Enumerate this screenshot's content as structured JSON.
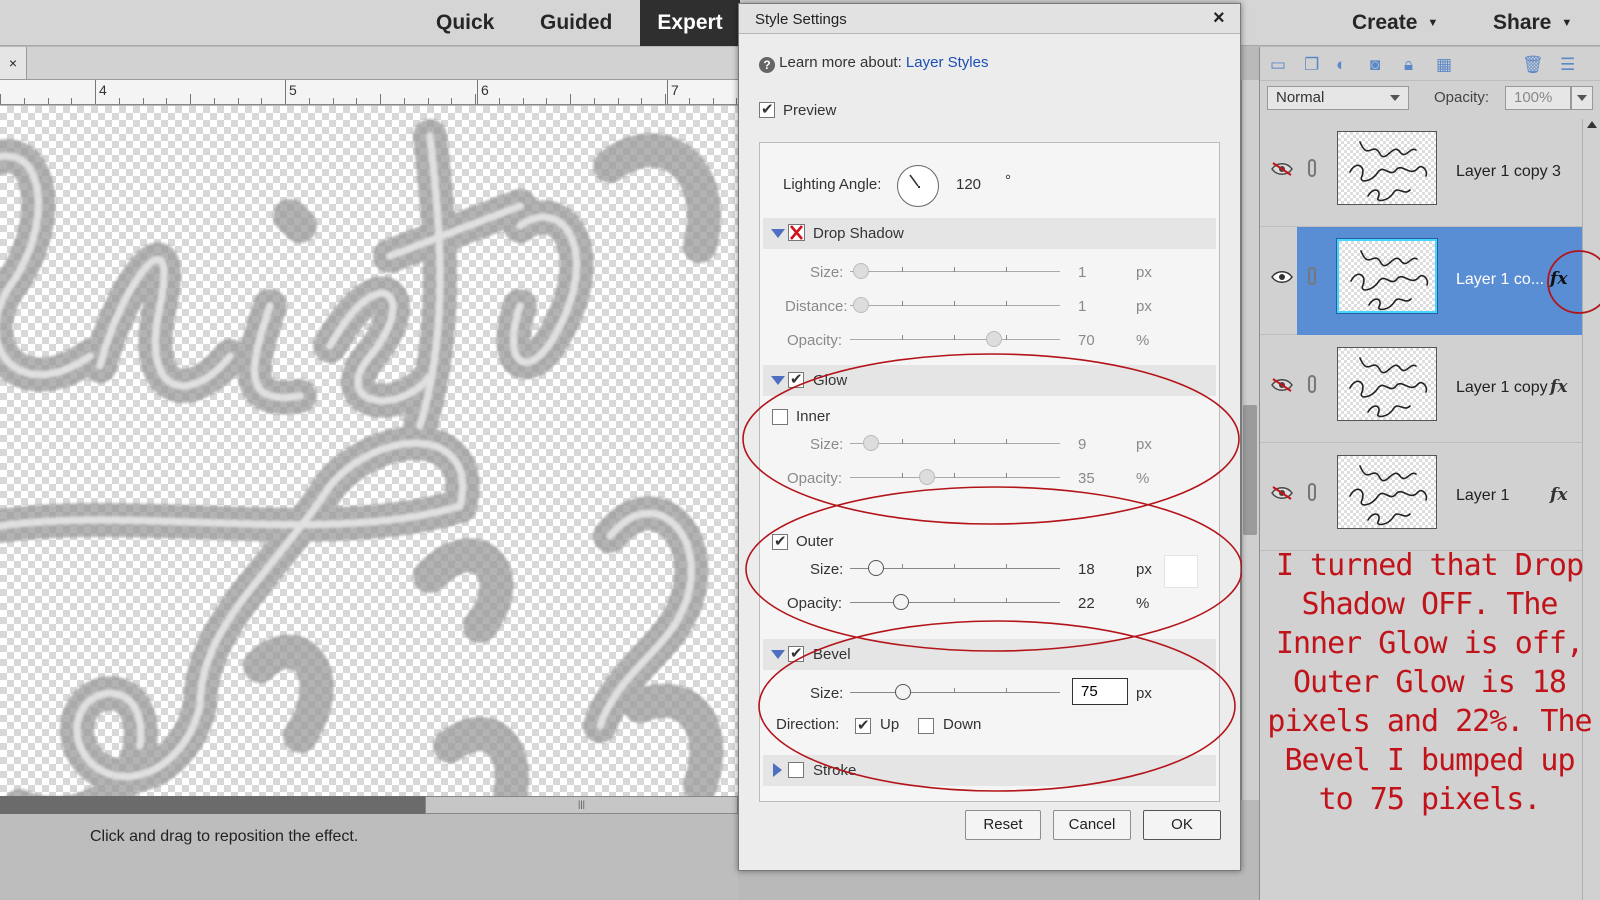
{
  "top_bar": {
    "modes": [
      "Quick",
      "Guided",
      "Expert"
    ],
    "active_mode": "Expert",
    "create_label": "Create",
    "share_label": "Share"
  },
  "canvas": {
    "tab_close": "×",
    "ruler_numbers": [
      "4",
      "5",
      "6",
      "7"
    ],
    "status_text": "Click and drag to reposition the effect.",
    "hscroll_grip": "|||"
  },
  "dialog": {
    "title": "Style Settings",
    "close": "×",
    "learn_more_text": "Learn more about:",
    "learn_more_link": "Layer Styles",
    "preview_label": "Preview",
    "preview_checked": true,
    "lighting_angle_label": "Lighting Angle:",
    "lighting_angle_value": "120",
    "degree_symbol": "°",
    "drop_shadow": {
      "title": "Drop Shadow",
      "enabled": false,
      "size_label": "Size:",
      "size_value": "1",
      "size_unit": "px",
      "distance_label": "Distance:",
      "distance_value": "1",
      "distance_unit": "px",
      "opacity_label": "Opacity:",
      "opacity_value": "70",
      "opacity_unit": "%"
    },
    "glow": {
      "title": "Glow",
      "enabled": true,
      "inner_label": "Inner",
      "inner_checked": false,
      "inner_size_label": "Size:",
      "inner_size_value": "9",
      "inner_size_unit": "px",
      "inner_opacity_label": "Opacity:",
      "inner_opacity_value": "35",
      "inner_opacity_unit": "%",
      "outer_label": "Outer",
      "outer_checked": true,
      "outer_size_label": "Size:",
      "outer_size_value": "18",
      "outer_size_unit": "px",
      "outer_opacity_label": "Opacity:",
      "outer_opacity_value": "22",
      "outer_opacity_unit": "%",
      "outer_color": "#ffffff"
    },
    "bevel": {
      "title": "Bevel",
      "enabled": true,
      "size_label": "Size:",
      "size_value": "75",
      "size_unit": "px",
      "direction_label": "Direction:",
      "up_label": "Up",
      "up_checked": true,
      "down_label": "Down",
      "down_checked": false
    },
    "stroke": {
      "title": "Stroke",
      "enabled": false
    },
    "buttons": {
      "reset": "Reset",
      "cancel": "Cancel",
      "ok": "OK"
    }
  },
  "layers_panel": {
    "blend_mode": "Normal",
    "opacity_label": "Opacity:",
    "opacity_value": "100%",
    "fx_symbol": "fx",
    "layers": [
      {
        "name": "Layer 1 copy 3",
        "visible": false,
        "has_fx": false,
        "selected": false
      },
      {
        "name": "Layer 1 co...",
        "visible": true,
        "has_fx": true,
        "selected": true
      },
      {
        "name": "Layer 1 copy",
        "visible": false,
        "has_fx": true,
        "selected": false
      },
      {
        "name": "Layer 1",
        "visible": false,
        "has_fx": true,
        "selected": false
      }
    ]
  },
  "annotation": {
    "text": "I turned that Drop Shadow OFF. The Inner Glow is off, Outer Glow is 18 pixels and 22%. The Bevel I bumped up to 75 pixels.",
    "color": "#c0131a"
  },
  "colors": {
    "annotation_red": "#c0131a",
    "selected_layer": "#5a8ed4",
    "link_blue": "#1b4fb5"
  }
}
